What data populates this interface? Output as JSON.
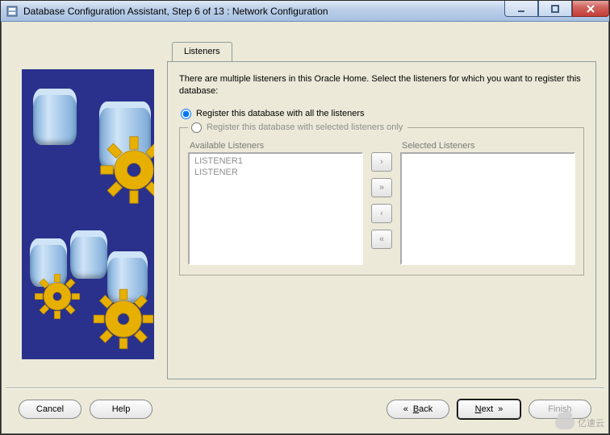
{
  "window": {
    "title": "Database Configuration Assistant, Step 6 of 13 : Network Configuration"
  },
  "tab": {
    "label": "Listeners"
  },
  "intro": "There are multiple listeners in this Oracle Home. Select the listeners for which you want to register this database:",
  "options": {
    "all": "Register this database with all the listeners",
    "selected": "Register this database with selected listeners only"
  },
  "lists": {
    "available_label": "Available Listeners",
    "selected_label": "Selected Listeners",
    "available": [
      "LISTENER1",
      "LISTENER"
    ],
    "selected": []
  },
  "transfer": {
    "add": "›",
    "add_all": "»",
    "remove": "‹",
    "remove_all": "«"
  },
  "footer": {
    "cancel": "Cancel",
    "help": "Help",
    "back": "Back",
    "back_glyph": "«",
    "next": "Next",
    "next_glyph": "»",
    "finish": "Finish"
  },
  "watermark": "亿速云"
}
